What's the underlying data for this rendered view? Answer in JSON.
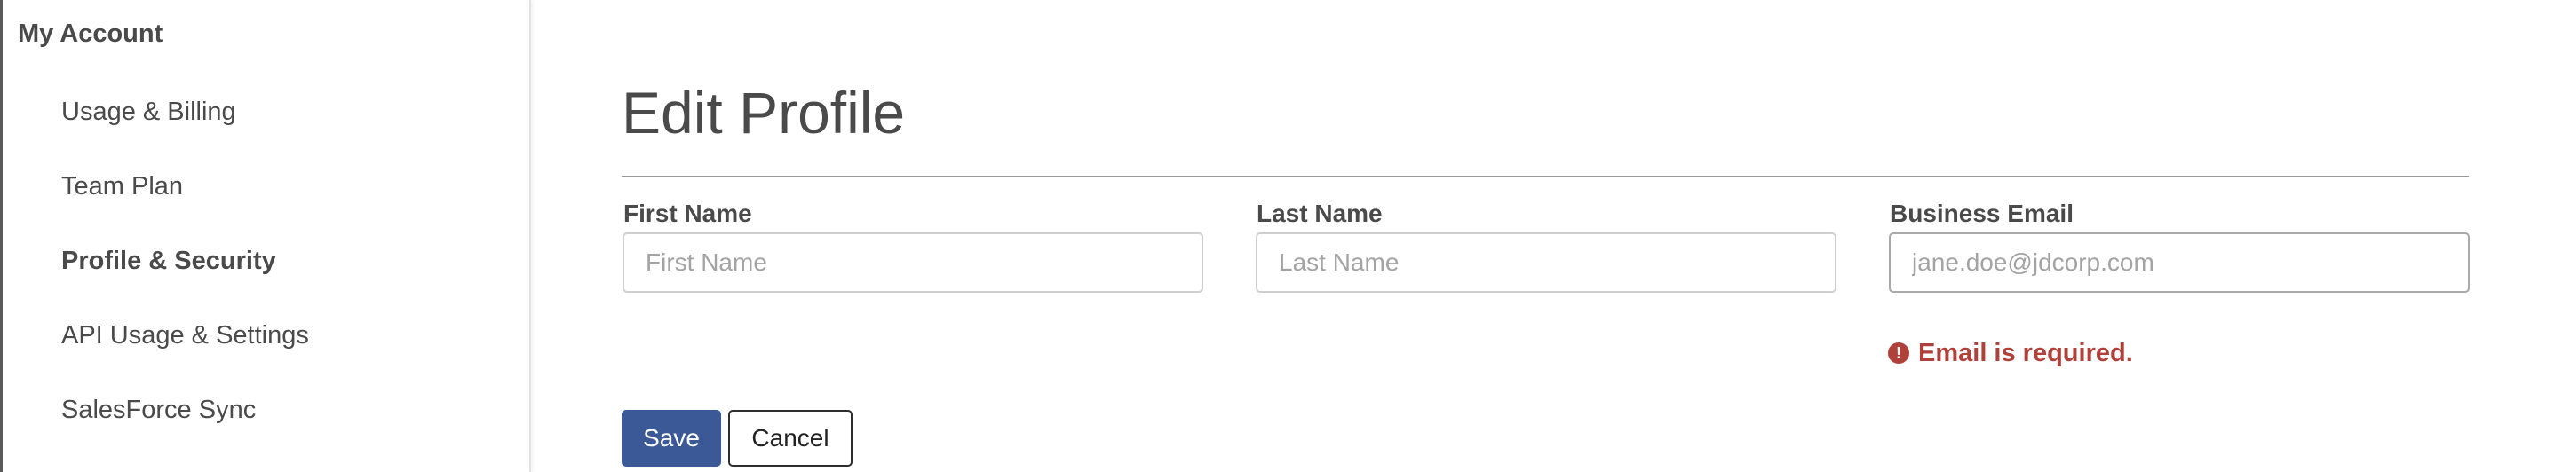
{
  "sidebar": {
    "heading": "My Account",
    "items": [
      {
        "label": "Usage & Billing",
        "active": false
      },
      {
        "label": "Team Plan",
        "active": false
      },
      {
        "label": "Profile & Security",
        "active": true
      },
      {
        "label": "API Usage & Settings",
        "active": false
      },
      {
        "label": "SalesForce Sync",
        "active": false
      }
    ]
  },
  "main": {
    "title": "Edit Profile",
    "fields": {
      "first_name": {
        "label": "First Name",
        "value": "",
        "placeholder": "First Name"
      },
      "last_name": {
        "label": "Last Name",
        "value": "",
        "placeholder": "Last Name"
      },
      "business_email": {
        "label": "Business Email",
        "value": "",
        "placeholder": "jane.doe@jdcorp.com"
      }
    },
    "error": {
      "icon": "exclamation-circle-icon",
      "glyph": "!",
      "message": "Email is required."
    },
    "buttons": {
      "save_label": "Save",
      "cancel_label": "Cancel"
    }
  },
  "colors": {
    "primary_button": "#3b5997",
    "error": "#b0403a",
    "text": "#4a4a4a"
  }
}
